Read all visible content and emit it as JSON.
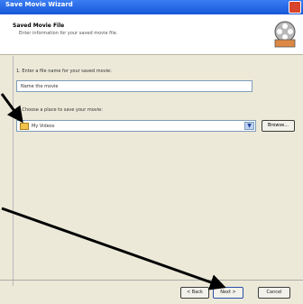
{
  "window": {
    "title": "Save Movie Wizard"
  },
  "header": {
    "title": "Saved Movie File",
    "subtitle": "Enter information for your saved movie file."
  },
  "step1": {
    "label": "1. Enter a file name for your saved movie:",
    "value": "Name the movie"
  },
  "step2": {
    "label": "2. Choose a place to save your movie:",
    "selected": "My Videos"
  },
  "buttons": {
    "browse": "Browse...",
    "back": "< Back",
    "next": "Next >",
    "cancel": "Cancel"
  },
  "icons": {
    "header_icon": "film-reel-icon",
    "folder": "folder-icon",
    "dropdown": "chevron-down-icon"
  },
  "colors": {
    "titlebar": "#1658d8",
    "annotation_arrow": "#000000"
  }
}
